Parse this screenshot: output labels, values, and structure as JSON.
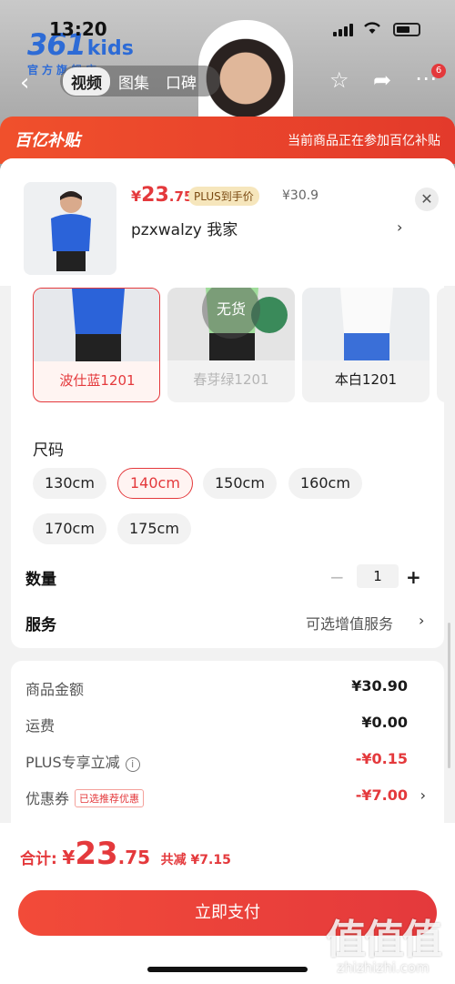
{
  "status": {
    "time": "13:20"
  },
  "brand": {
    "logo_number": "361",
    "logo_suffix": "kids",
    "store_sub": "官方旗舰店"
  },
  "top_tabs": [
    {
      "label": "视频"
    },
    {
      "label": "图集"
    },
    {
      "label": "口碑"
    }
  ],
  "nav": {
    "badge_count": "6"
  },
  "banner": {
    "logo": "百亿补贴",
    "notice": "当前商品正在参加百亿补贴"
  },
  "product": {
    "price_currency": "¥",
    "price_int": "23",
    "price_dec": ".75",
    "plus_tag": "PLUS到手价",
    "original_price": "¥30.9",
    "address": "pzxwalzy  我家"
  },
  "colors": [
    {
      "label": "波仕蓝1201",
      "state": "selected"
    },
    {
      "label": "春芽绿1201",
      "state": "sold-out",
      "overlay": "无货"
    },
    {
      "label": "本白1201",
      "state": "normal"
    }
  ],
  "sizes": {
    "title": "尺码",
    "items": [
      {
        "label": "130cm"
      },
      {
        "label": "140cm"
      },
      {
        "label": "150cm"
      },
      {
        "label": "160cm"
      },
      {
        "label": "170cm"
      },
      {
        "label": "175cm"
      }
    ],
    "selected": "140cm"
  },
  "quantity": {
    "label": "数量",
    "value": "1",
    "minus": "−",
    "plus": "+"
  },
  "service": {
    "label": "服务",
    "value": "可选增值服务"
  },
  "summary": {
    "rows": [
      {
        "label": "商品金额",
        "value": "¥30.90"
      },
      {
        "label": "运费",
        "value": "¥0.00"
      },
      {
        "label": "PLUS专享立减",
        "value": "-¥0.15"
      },
      {
        "label": "优惠券",
        "value": "-¥7.00",
        "tag": "已选推荐优惠"
      }
    ]
  },
  "checkout": {
    "total_label": "合计:",
    "currency": "¥",
    "total_int": "23",
    "total_dec": ".75",
    "saved": "共减 ¥7.15",
    "pay_button": "立即支付"
  },
  "watermark": {
    "text": "值值值",
    "url": "zhizhizhi.com"
  },
  "accent": {
    "red": "#e4393c",
    "orange": "#f0502c",
    "brand_blue": "#2d6bd6"
  }
}
